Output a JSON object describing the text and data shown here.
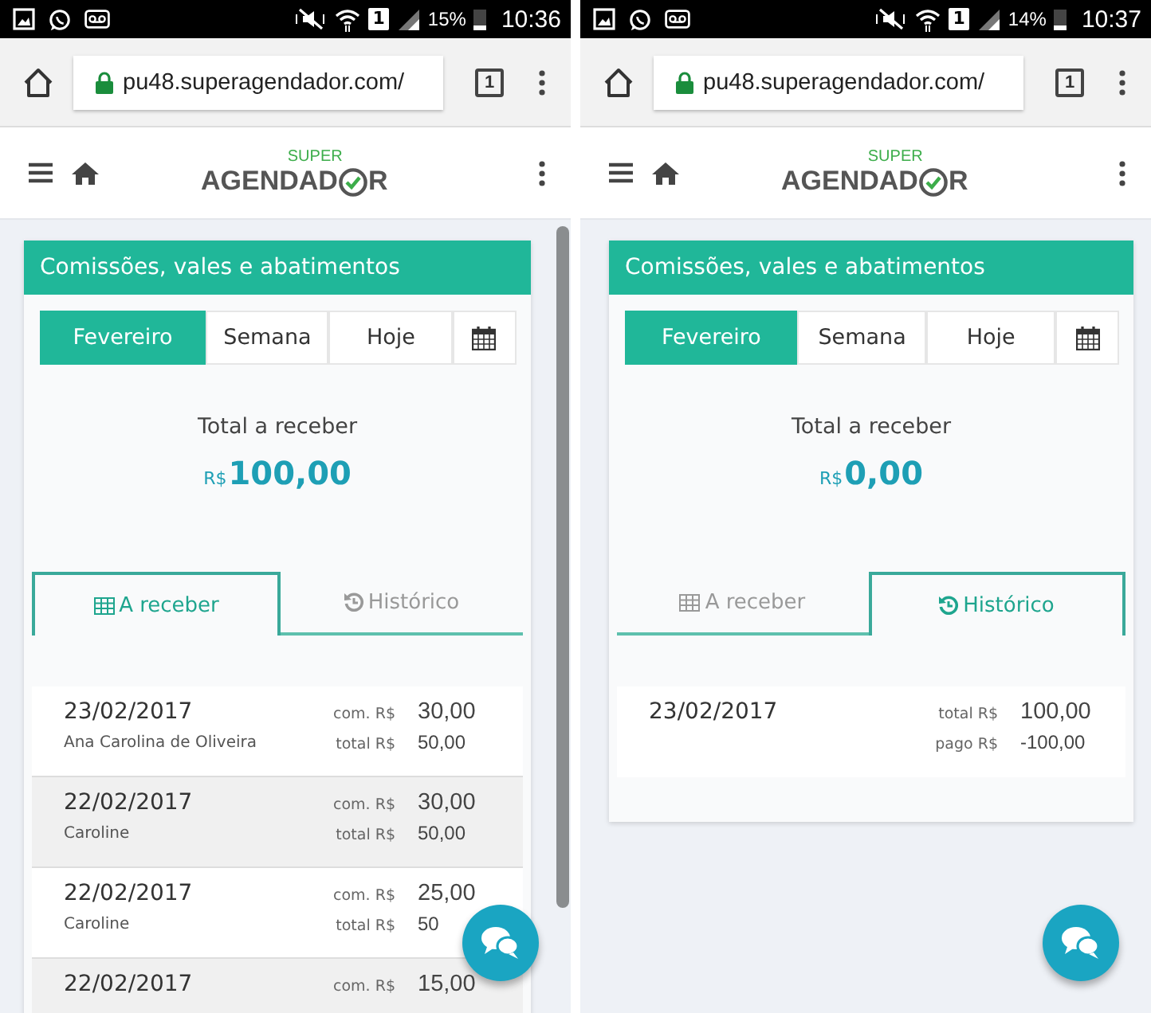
{
  "phones": [
    {
      "status_bar": {
        "sim": "1",
        "battery": "15%",
        "time": "10:36"
      },
      "browser": {
        "url": "pu48.superagendador.com/",
        "tab_count": "1"
      },
      "logo": {
        "small": "SUPER",
        "before": "AGENDAD",
        "after": "R"
      },
      "card_title": "Comissões, vales e abatimentos",
      "period_buttons": [
        {
          "kind": "text",
          "label": "Fevereiro",
          "selected": true
        },
        {
          "kind": "text",
          "label": "Semana",
          "selected": false
        },
        {
          "kind": "text",
          "label": "Hoje",
          "selected": false
        },
        {
          "kind": "calendar",
          "selected": false
        }
      ],
      "total": {
        "label": "Total a receber",
        "currency": "R$",
        "amount": "100,00"
      },
      "tabs": [
        {
          "kind": "table",
          "label": "A receber",
          "selected": true
        },
        {
          "kind": "history",
          "label": "Histórico",
          "selected": false
        }
      ],
      "rows": [
        {
          "date": "23/02/2017",
          "name": "Ana Carolina de Oliveira",
          "lines": [
            {
              "label": "com. R$",
              "value": "30,00"
            },
            {
              "label": "total R$",
              "value": "50,00"
            }
          ]
        },
        {
          "date": "22/02/2017",
          "name": "Caroline",
          "lines": [
            {
              "label": "com. R$",
              "value": "30,00"
            },
            {
              "label": "total R$",
              "value": "50,00"
            }
          ]
        },
        {
          "date": "22/02/2017",
          "name": "Caroline",
          "lines": [
            {
              "label": "com. R$",
              "value": "25,00"
            },
            {
              "label": "total R$",
              "value": "50"
            }
          ]
        },
        {
          "date": "22/02/2017",
          "lines": [
            {
              "label": "com. R$",
              "value": "15,00"
            }
          ]
        }
      ],
      "scrollbar": true
    },
    {
      "status_bar": {
        "sim": "1",
        "battery": "14%",
        "time": "10:37"
      },
      "browser": {
        "url": "pu48.superagendador.com/",
        "tab_count": "1"
      },
      "logo": {
        "small": "SUPER",
        "before": "AGENDAD",
        "after": "R"
      },
      "card_title": "Comissões, vales e abatimentos",
      "period_buttons": [
        {
          "kind": "text",
          "label": "Fevereiro",
          "selected": true
        },
        {
          "kind": "text",
          "label": "Semana",
          "selected": false
        },
        {
          "kind": "text",
          "label": "Hoje",
          "selected": false
        },
        {
          "kind": "calendar",
          "selected": false
        }
      ],
      "total": {
        "label": "Total a receber",
        "currency": "R$",
        "amount": "0,00"
      },
      "tabs": [
        {
          "kind": "table",
          "label": "A receber",
          "selected": false
        },
        {
          "kind": "history",
          "label": "Histórico",
          "selected": true
        }
      ],
      "rows": [
        {
          "date": "23/02/2017",
          "lines": [
            {
              "label": "total R$",
              "value": "100,00"
            },
            {
              "label": "pago R$",
              "value": "-100,00"
            }
          ]
        }
      ],
      "scrollbar": false
    }
  ]
}
